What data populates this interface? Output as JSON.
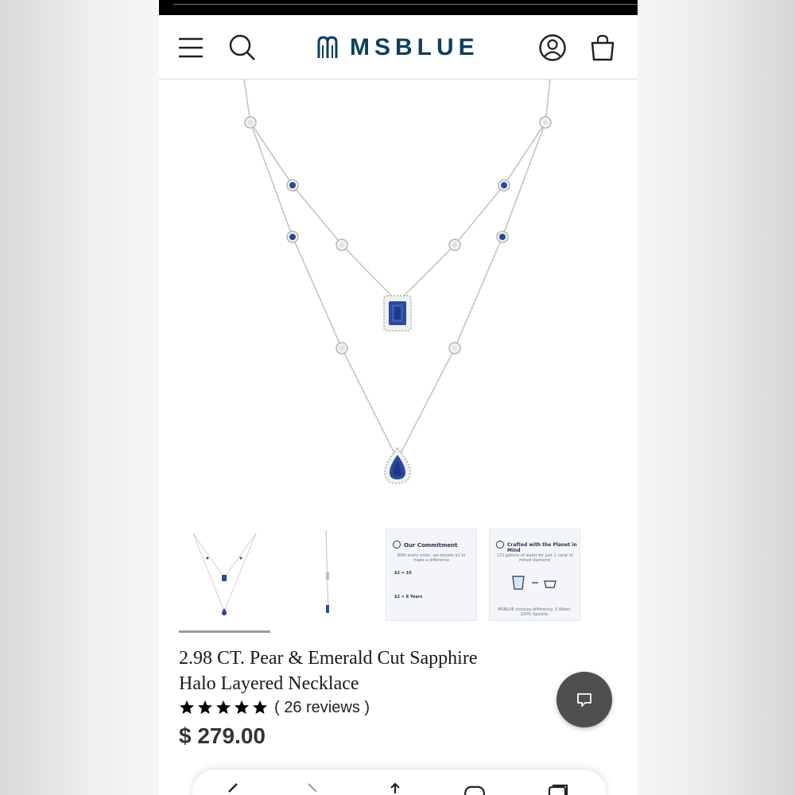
{
  "brand": {
    "logo_text": "MSBLUE",
    "color": "#0f3f5a"
  },
  "header": {
    "icons": [
      "menu-icon",
      "search-icon",
      "account-icon",
      "cart-icon"
    ]
  },
  "product": {
    "title_line1": "2.98 CT. Pear & Emerald Cut Sapphire",
    "title_line2": "Halo Layered Necklace",
    "rating_stars": 5,
    "reviews_label": "( 26 reviews )",
    "price": "$ 279.00"
  },
  "gallery": {
    "thumbnails": [
      {
        "type": "image",
        "name": "necklace-front"
      },
      {
        "type": "image",
        "name": "necklace-side"
      },
      {
        "type": "card",
        "title": "Our Commitment",
        "subtitle": "With every order, we donate $2 to make a difference",
        "row1": "$2 = 10",
        "row2": "$2 = 8 Years"
      },
      {
        "type": "card",
        "title": "Crafted with the Planet in Mind",
        "subtitle": "123 gallons of water for just 1 carat of mined diamond",
        "footer": "MSBLUE chooses differently. 0 Water. 100% Sparkle."
      }
    ],
    "active_index": 0
  },
  "bottom_nav": {
    "icons": [
      "back-icon",
      "forward-icon",
      "share-icon",
      "bookmarks-icon",
      "tabs-icon"
    ]
  },
  "colors": {
    "sapphire": "#2a4a9b",
    "silver": "#bdbdbd"
  }
}
